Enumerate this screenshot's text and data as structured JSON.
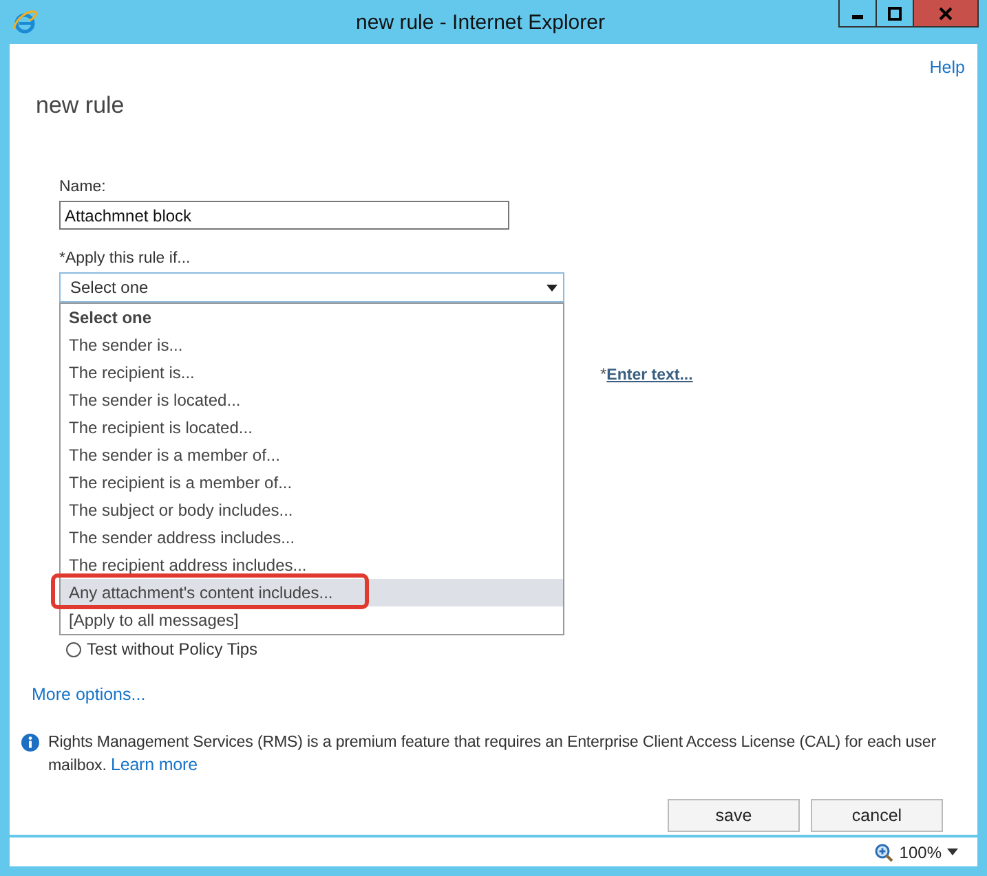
{
  "window": {
    "title": "new rule - Internet Explorer"
  },
  "help_link": "Help",
  "heading": "new rule",
  "name_field": {
    "label": "Name:",
    "value": "Attachmnet block"
  },
  "condition": {
    "label": "*Apply this rule if...",
    "value": "Select one",
    "expanded": true,
    "options": [
      {
        "label": "Select one",
        "kind": "header",
        "highlighted": false,
        "annotated": false
      },
      {
        "label": "The sender is...",
        "kind": "option",
        "highlighted": false,
        "annotated": false
      },
      {
        "label": "The recipient is...",
        "kind": "option",
        "highlighted": false,
        "annotated": false
      },
      {
        "label": "The sender is located...",
        "kind": "option",
        "highlighted": false,
        "annotated": false
      },
      {
        "label": "The recipient is located...",
        "kind": "option",
        "highlighted": false,
        "annotated": false
      },
      {
        "label": "The sender is a member of...",
        "kind": "option",
        "highlighted": false,
        "annotated": false
      },
      {
        "label": "The recipient is a member of...",
        "kind": "option",
        "highlighted": false,
        "annotated": false
      },
      {
        "label": "The subject or body includes...",
        "kind": "option",
        "highlighted": false,
        "annotated": false
      },
      {
        "label": "The sender address includes...",
        "kind": "option",
        "highlighted": false,
        "annotated": false
      },
      {
        "label": "The recipient address includes...",
        "kind": "option",
        "highlighted": false,
        "annotated": false
      },
      {
        "label": "Any attachment's content includes...",
        "kind": "option",
        "highlighted": true,
        "annotated": true
      },
      {
        "label": "[Apply to all messages]",
        "kind": "option",
        "highlighted": false,
        "annotated": false
      }
    ]
  },
  "enter_text": {
    "prefix": "*",
    "link": "Enter text..."
  },
  "policy_radio": {
    "label": "Test without Policy Tips",
    "selected": false
  },
  "more_options": "More options...",
  "info": {
    "text": "Rights Management Services (RMS) is a premium feature that requires an Enterprise Client Access License (CAL) for each user mailbox.",
    "link": "Learn more"
  },
  "buttons": [
    "save",
    "cancel"
  ],
  "status_bar": {
    "zoom": "100%"
  }
}
